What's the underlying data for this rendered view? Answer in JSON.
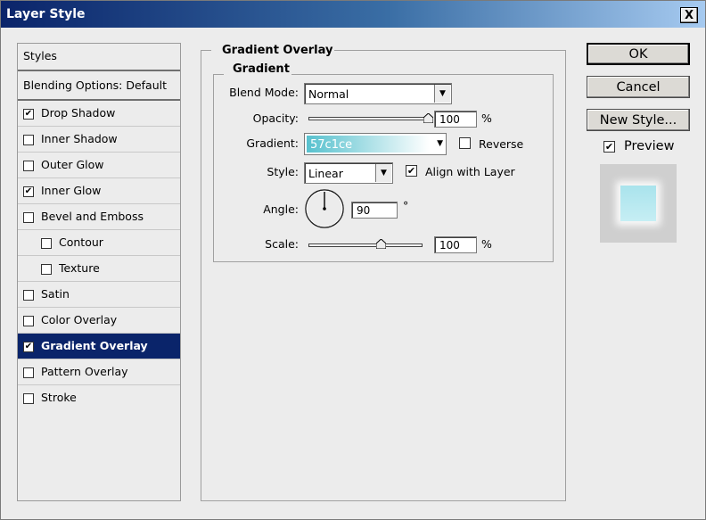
{
  "window": {
    "title": "Layer Style",
    "close_label": "X"
  },
  "styles_list": {
    "header": "Styles",
    "blending": "Blending Options: Default",
    "items": [
      {
        "label": "Drop Shadow",
        "checked": true,
        "sub": false,
        "selected": false
      },
      {
        "label": "Inner Shadow",
        "checked": false,
        "sub": false,
        "selected": false
      },
      {
        "label": "Outer Glow",
        "checked": false,
        "sub": false,
        "selected": false
      },
      {
        "label": "Inner Glow",
        "checked": true,
        "sub": false,
        "selected": false
      },
      {
        "label": "Bevel and Emboss",
        "checked": false,
        "sub": false,
        "selected": false
      },
      {
        "label": "Contour",
        "checked": false,
        "sub": true,
        "selected": false
      },
      {
        "label": "Texture",
        "checked": false,
        "sub": true,
        "selected": false
      },
      {
        "label": "Satin",
        "checked": false,
        "sub": false,
        "selected": false
      },
      {
        "label": "Color Overlay",
        "checked": false,
        "sub": false,
        "selected": false
      },
      {
        "label": "Gradient Overlay",
        "checked": true,
        "sub": false,
        "selected": true
      },
      {
        "label": "Pattern Overlay",
        "checked": false,
        "sub": false,
        "selected": false
      },
      {
        "label": "Stroke",
        "checked": false,
        "sub": false,
        "selected": false
      }
    ]
  },
  "panel": {
    "title": "Gradient Overlay",
    "group_title": "Gradient",
    "blend_mode_label": "Blend Mode:",
    "blend_mode_value": "Normal",
    "opacity_label": "Opacity:",
    "opacity_value": "100",
    "opacity_level": 1.0,
    "percent": "%",
    "gradient_label": "Gradient:",
    "gradient_text": "57c1ce",
    "gradient_start": "#57c1ce",
    "gradient_end": "#ffffff",
    "reverse_label": "Reverse",
    "reverse_checked": false,
    "style_label": "Style:",
    "style_value": "Linear",
    "align_label": "Align with Layer",
    "align_checked": true,
    "angle_label": "Angle:",
    "angle_value": "90",
    "degree": "°",
    "scale_label": "Scale:",
    "scale_value": "100",
    "scale_level": 0.64
  },
  "buttons": {
    "ok": "OK",
    "cancel": "Cancel",
    "new_style": "New Style..."
  },
  "preview": {
    "label": "Preview",
    "checked": true
  },
  "colors": {
    "selection": "#0a246a",
    "accent_gradient": "#57c1ce"
  }
}
